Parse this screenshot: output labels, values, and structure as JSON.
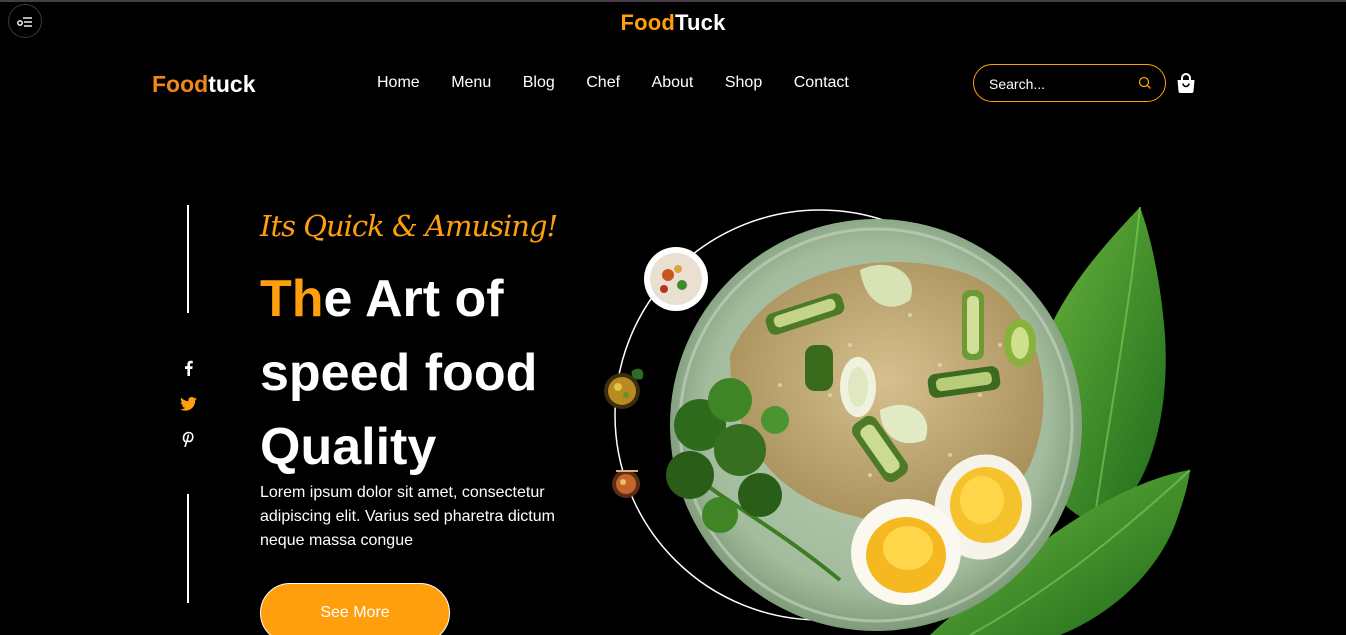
{
  "site": {
    "brand_top": {
      "part1": "Food",
      "part2": "Tuck"
    },
    "logo": {
      "part1": "Food",
      "part2": "tuck"
    }
  },
  "nav": {
    "items": [
      {
        "label": "Home"
      },
      {
        "label": "Menu"
      },
      {
        "label": "Blog"
      },
      {
        "label": "Chef"
      },
      {
        "label": "About"
      },
      {
        "label": "Shop"
      },
      {
        "label": "Contact"
      }
    ]
  },
  "search": {
    "placeholder": "Search...",
    "icon": "search-icon"
  },
  "cart": {
    "icon": "shopping-bag-icon"
  },
  "social": [
    {
      "icon": "facebook-icon"
    },
    {
      "icon": "twitter-icon"
    },
    {
      "icon": "pinterest-icon"
    }
  ],
  "hero": {
    "tagline": "Its Quick & Amusing!",
    "headline_highlight": "Th",
    "headline_line1_rest": "e Art of",
    "headline_line2": "speed food",
    "headline_line3": "Quality",
    "description": "Lorem ipsum dolor sit amet, consectetur adipiscing elit. Varius sed pharetra dictum neque massa congue",
    "cta_label": "See More"
  },
  "colors": {
    "accent": "#ff9f0d",
    "logo_accent": "#f0871a",
    "background": "#000000",
    "text": "#ffffff"
  }
}
